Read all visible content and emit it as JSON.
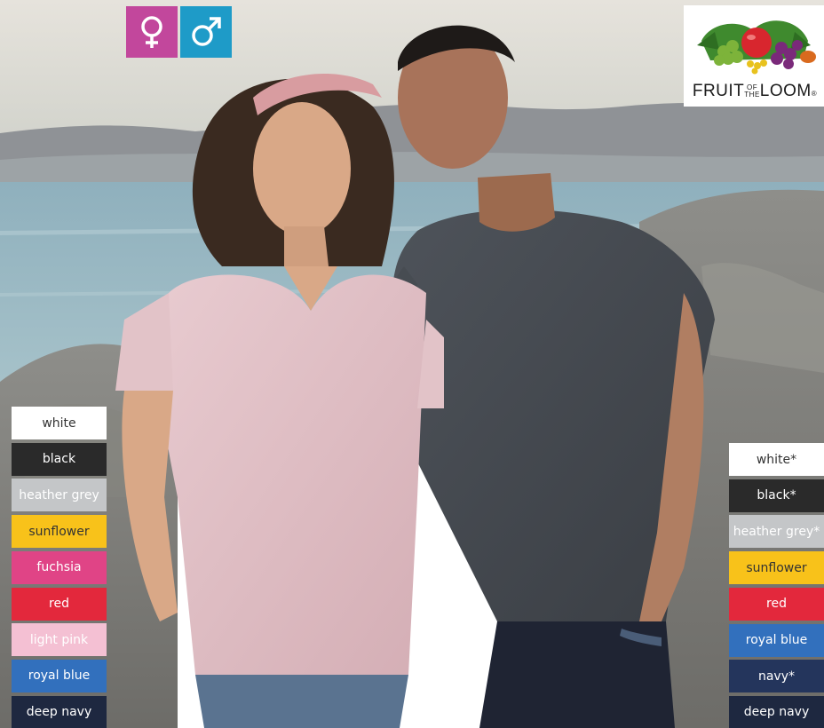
{
  "gender_icons": [
    {
      "name": "female-icon",
      "symbol": "♀",
      "color": "#C2479C"
    },
    {
      "name": "male-icon",
      "symbol": "♂",
      "color": "#1E9BC8"
    }
  ],
  "logo": {
    "text_main_1": "FRUIT",
    "text_of": "OF",
    "text_the": "THE",
    "text_main_2": "LOOM",
    "mark": "®"
  },
  "left_colors": [
    {
      "label": "white",
      "bg": "#FFFFFF",
      "fg": "#333333"
    },
    {
      "label": "black",
      "bg": "#2A2A2A",
      "fg": "#FFFFFF"
    },
    {
      "label": "heather grey",
      "bg": "#C4C6C8",
      "fg": "#FFFFFF"
    },
    {
      "label": "sunflower",
      "bg": "#F8C21A",
      "fg": "#333333"
    },
    {
      "label": "fuchsia",
      "bg": "#E04486",
      "fg": "#FFFFFF"
    },
    {
      "label": "red",
      "bg": "#E3283C",
      "fg": "#FFFFFF"
    },
    {
      "label": "light pink",
      "bg": "#F4C0D3",
      "fg": "#FFFFFF"
    },
    {
      "label": "royal blue",
      "bg": "#3270BD",
      "fg": "#FFFFFF"
    },
    {
      "label": "deep navy",
      "bg": "#1E2840",
      "fg": "#FFFFFF"
    }
  ],
  "right_colors": [
    {
      "label": "white*",
      "bg": "#FFFFFF",
      "fg": "#333333"
    },
    {
      "label": "black*",
      "bg": "#2A2A2A",
      "fg": "#FFFFFF"
    },
    {
      "label": "heather grey*",
      "bg": "#C4C6C8",
      "fg": "#FFFFFF"
    },
    {
      "label": "sunflower",
      "bg": "#F8C21A",
      "fg": "#333333"
    },
    {
      "label": "red",
      "bg": "#E3283C",
      "fg": "#FFFFFF"
    },
    {
      "label": "royal blue",
      "bg": "#3270BD",
      "fg": "#FFFFFF"
    },
    {
      "label": "navy*",
      "bg": "#24355C",
      "fg": "#FFFFFF"
    },
    {
      "label": "deep navy",
      "bg": "#1E2840",
      "fg": "#FFFFFF"
    }
  ]
}
